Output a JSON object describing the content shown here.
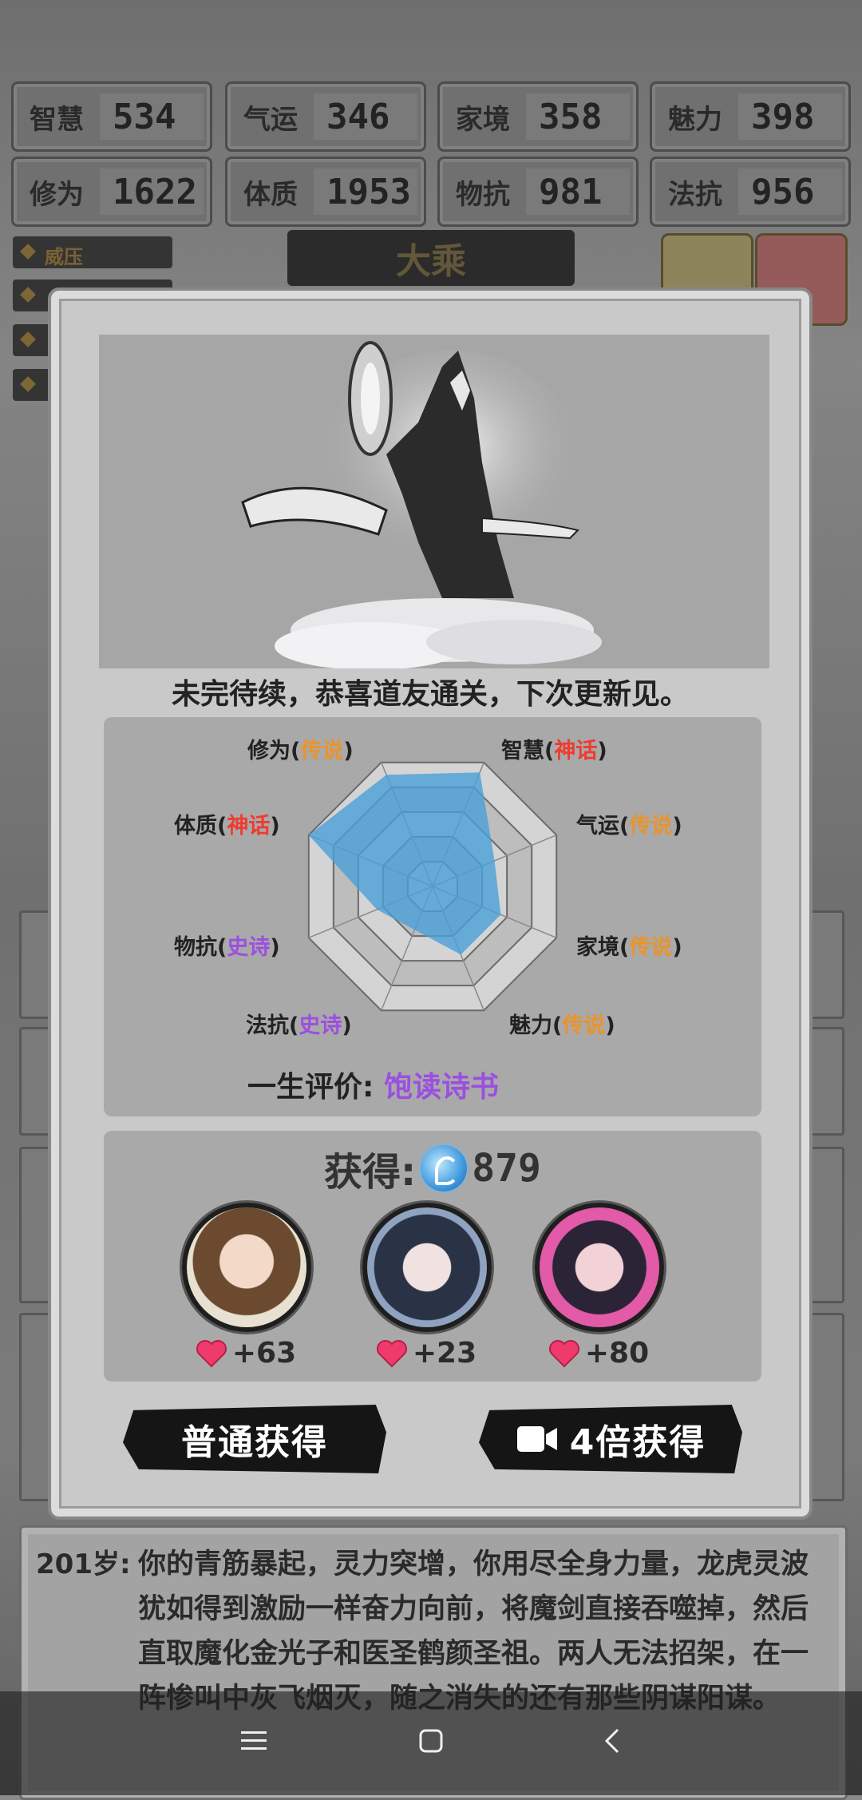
{
  "stats": [
    {
      "label": "智慧",
      "value": "534"
    },
    {
      "label": "气运",
      "value": "346"
    },
    {
      "label": "家境",
      "value": "358"
    },
    {
      "label": "魅力",
      "value": "398"
    },
    {
      "label": "修为",
      "value": "1622"
    },
    {
      "label": "体质",
      "value": "1953"
    },
    {
      "label": "物抗",
      "value": "981"
    },
    {
      "label": "法抗",
      "value": "956"
    }
  ],
  "realm": "大乘",
  "side_tag": "威压",
  "modal": {
    "subtitle": "未完待续，恭喜道友通关，下次更新见。",
    "radar": {
      "labels": [
        {
          "name": "修为",
          "tier": "传说",
          "tier_class": "leg"
        },
        {
          "name": "智慧",
          "tier": "神话",
          "tier_class": "myth"
        },
        {
          "name": "气运",
          "tier": "传说",
          "tier_class": "leg"
        },
        {
          "name": "家境",
          "tier": "传说",
          "tier_class": "leg"
        },
        {
          "name": "魅力",
          "tier": "传说",
          "tier_class": "leg"
        },
        {
          "name": "法抗",
          "tier": "史诗",
          "tier_class": "epic"
        },
        {
          "name": "物抗",
          "tier": "史诗",
          "tier_class": "epic"
        },
        {
          "name": "体质",
          "tier": "神话",
          "tier_class": "myth"
        }
      ],
      "colors": {
        "myth": "#ef3b2f",
        "legend": "#e9942c",
        "epic": "#9b4fe0",
        "fill": "#4a9fd8"
      }
    },
    "evaluation_label": "一生评价:",
    "evaluation_value": "饱读诗书",
    "gain_label": "获得:",
    "gain_amount": "879",
    "characters": [
      {
        "bonus": "+63"
      },
      {
        "bonus": "+23"
      },
      {
        "bonus": "+80"
      }
    ],
    "buttons": {
      "normal": "普通获得",
      "double": "4倍获得"
    }
  },
  "story": {
    "age": "201岁:",
    "text": "你的青筋暴起，灵力突增，你用尽全身力量，龙虎灵波犹如得到激励一样奋力向前，将魔剑直接吞噬掉，然后直取魔化金光子和医圣鹤颜圣祖。两人无法招架，在一阵惨叫中灰飞烟灭，随之消失的还有那些阴谋阳谋。"
  }
}
